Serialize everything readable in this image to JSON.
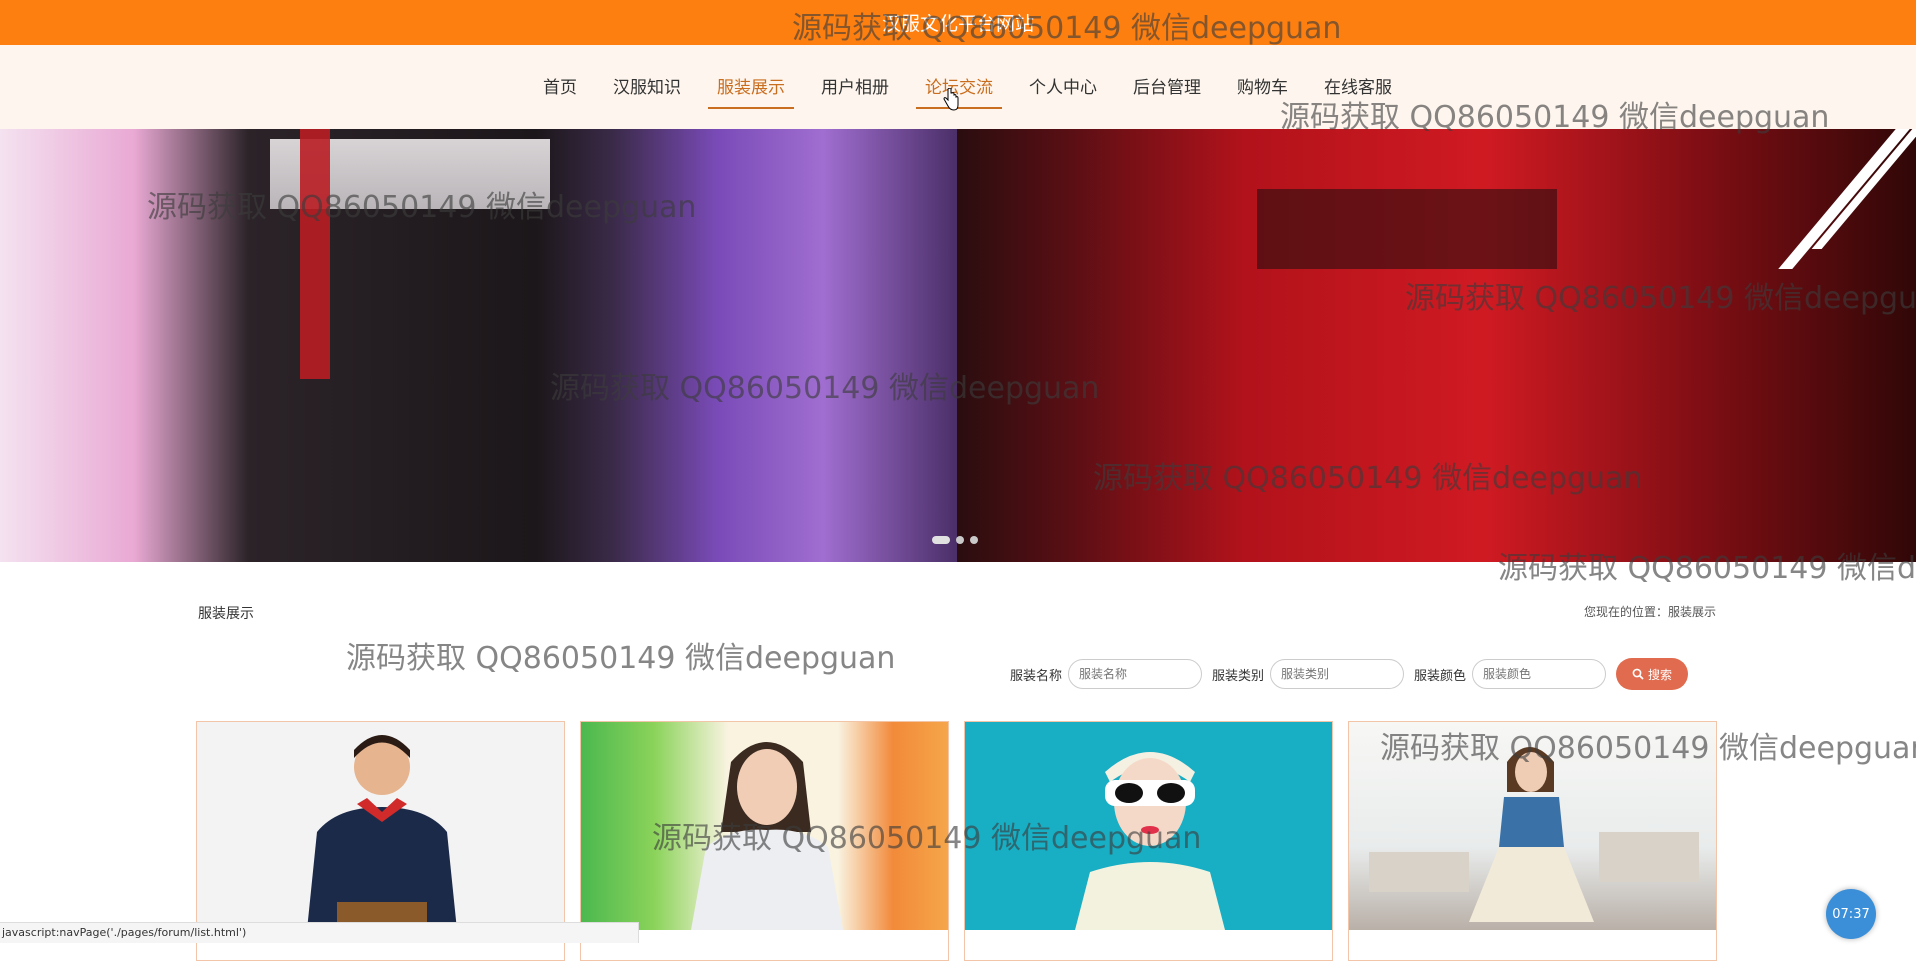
{
  "site": {
    "title": "汉服文化平台网站"
  },
  "nav": {
    "items": [
      "首页",
      "汉服知识",
      "服装展示",
      "用户相册",
      "论坛交流",
      "个人中心",
      "后台管理",
      "购物车",
      "在线客服"
    ],
    "active_index": 2,
    "hover_index": 4
  },
  "banner": {
    "slide_count": 3,
    "active_slide": 0
  },
  "section": {
    "title": "服装展示",
    "breadcrumb": "您现在的位置：服装展示"
  },
  "search": {
    "name_label": "服装名称",
    "name_placeholder": "服装名称",
    "type_label": "服装类别",
    "type_placeholder": "服装类别",
    "color_label": "服装颜色",
    "color_placeholder": "服装颜色",
    "button_label": "搜索"
  },
  "status_bar": {
    "text": "javascript:navPage('./pages/forum/list.html')"
  },
  "clock": {
    "time": "07:37"
  },
  "watermark": {
    "text": "源码获取 QQ86050149 微信deepguan"
  },
  "colors": {
    "topbar": "#fd7f10",
    "nav_active": "#c96d1f",
    "search_button": "#e06b4e",
    "clock": "#3a8fd8"
  }
}
